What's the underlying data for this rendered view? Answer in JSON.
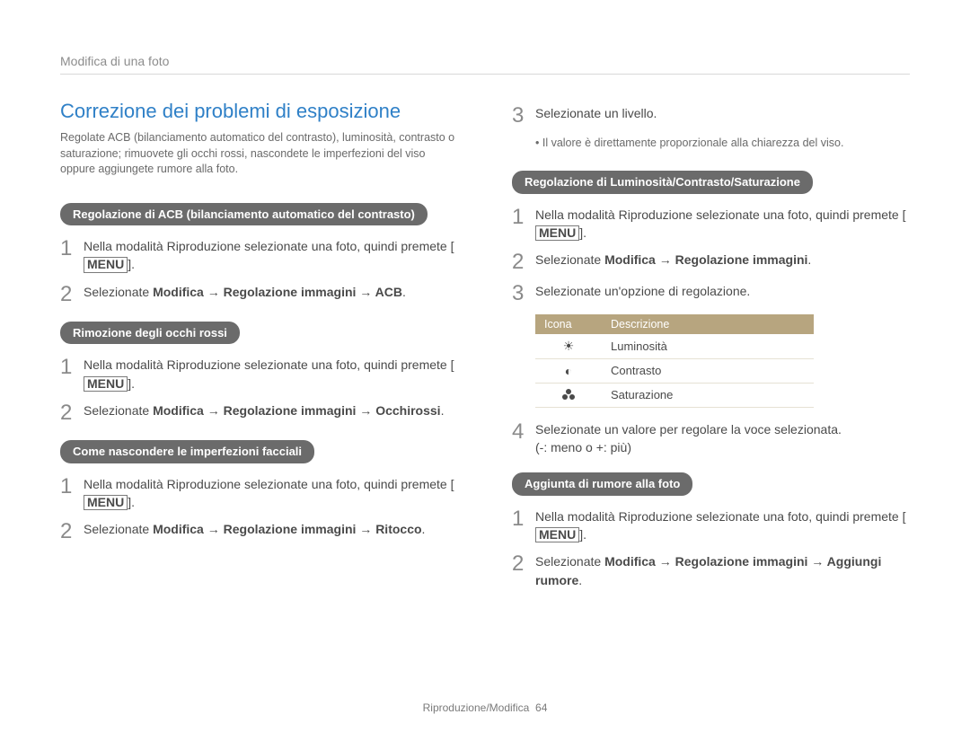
{
  "header": "Modifica di una foto",
  "title": "Correzione dei problemi di esposizione",
  "intro": "Regolate ACB (bilanciamento automatico del contrasto), luminosità, contrasto o saturazione; rimuovete gli occhi rossi, nascondete le imperfezioni del viso oppure aggiungete rumore alla foto.",
  "pill_acb": "Regolazione di ACB (bilanciamento automatico del contrasto)",
  "acb_step1_pre": "Nella modalità Riproduzione selezionate una foto, quindi premete [",
  "acb_step1_menu": "MENU",
  "acb_step1_post": "].",
  "acb_step2_pre": "Selezionate ",
  "acb_step2_bold": "Modifica → Regolazione immagini → ACB",
  "acb_step2_post": ".",
  "pill_redeye": "Rimozione degli occhi rossi",
  "redeye_step1_pre": "Nella modalità Riproduzione selezionate una foto, quindi premete [",
  "redeye_step1_menu": "MENU",
  "redeye_step1_post": "].",
  "redeye_step2_pre": "Selezionate ",
  "redeye_step2_bold": "Modifica → Regolazione immagini → Occhirossi",
  "redeye_step2_post": ".",
  "pill_face": "Come nascondere le imperfezioni facciali",
  "face_step1_pre": "Nella modalità Riproduzione selezionate una foto, quindi premete [",
  "face_step1_menu": "MENU",
  "face_step1_post": "].",
  "face_step2_pre": "Selezionate ",
  "face_step2_bold": "Modifica → Regolazione immagini → Ritocco",
  "face_step2_post": ".",
  "face_step3": "Selezionate un livello.",
  "face_bullet": "Il valore è direttamente proporzionale alla chiarezza del viso.",
  "pill_bcs": "Regolazione di Luminosità/Contrasto/Saturazione",
  "bcs_step1_pre": "Nella modalità Riproduzione selezionate una foto, quindi premete [",
  "bcs_step1_menu": "MENU",
  "bcs_step1_post": "].",
  "bcs_step2_pre": "Selezionate ",
  "bcs_step2_bold": "Modifica → Regolazione immagini",
  "bcs_step2_post": ".",
  "bcs_step3": "Selezionate un'opzione di regolazione.",
  "table": {
    "head_icon": "Icona",
    "head_desc": "Descrizione",
    "rows": [
      {
        "icon": "☀",
        "desc": "Luminosità"
      },
      {
        "icon": "◐",
        "desc": "Contrasto"
      },
      {
        "icon": "sat",
        "desc": "Saturazione"
      }
    ]
  },
  "bcs_step4_a": "Selezionate un valore per regolare la voce selezionata.",
  "bcs_step4_b": "(-: meno o +: più)",
  "pill_noise": "Aggiunta di rumore alla foto",
  "noise_step1_pre": "Nella modalità Riproduzione selezionate una foto, quindi premete [",
  "noise_step1_menu": "MENU",
  "noise_step1_post": "].",
  "noise_step2_pre": "Selezionate ",
  "noise_step2_bold": "Modifica → Regolazione immagini → Aggiungi rumore",
  "noise_step2_post": ".",
  "footer_section": "Riproduzione/Modifica",
  "footer_page": "64"
}
